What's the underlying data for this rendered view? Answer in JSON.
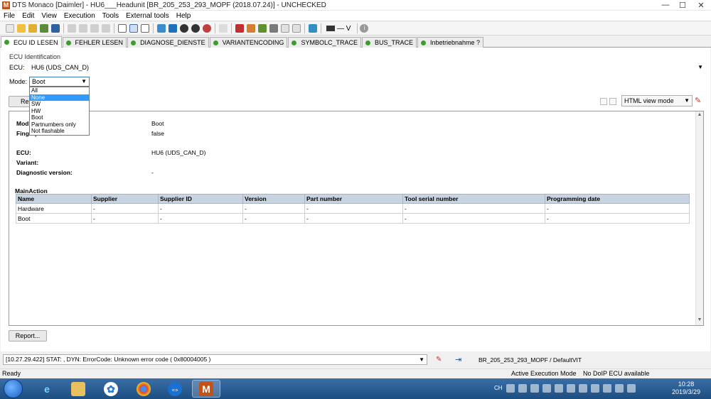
{
  "window": {
    "title": "DTS Monaco [Daimler] - HU6___Headunit [BR_205_253_293_MOPF (2018.07.24)] - UNCHECKED",
    "logo_letter": "M",
    "minimize": "—",
    "maximize": "☐",
    "close": "✕"
  },
  "menu": [
    "File",
    "Edit",
    "View",
    "Execution",
    "Tools",
    "External tools",
    "Help"
  ],
  "toolbar": {
    "voltage_label": "— V",
    "info_glyph": "i"
  },
  "tabs": [
    {
      "label": "ECU ID LESEN",
      "active": true
    },
    {
      "label": "FEHLER LESEN",
      "active": false
    },
    {
      "label": "DIAGNOSE_DIENSTE",
      "active": false
    },
    {
      "label": "VARIANTENCODING",
      "active": false
    },
    {
      "label": "SYMBOLC_TRACE",
      "active": false
    },
    {
      "label": "BUS_TRACE",
      "active": false
    },
    {
      "label": "Inbetriebnahme ?",
      "active": false
    }
  ],
  "panel": {
    "section_title": "ECU Identification",
    "ecu_label": "ECU:",
    "ecu_value": "HU6 (UDS_CAN_D)",
    "mode_label": "Mode:",
    "mode_value": "Boot",
    "mode_options": [
      "All",
      "None",
      "SW",
      "HW",
      "Boot",
      "Partnumbers only",
      "Not flashable"
    ],
    "mode_highlighted": "None",
    "read_button": "Re",
    "view_mode": "HTML view mode",
    "arrow_glyph": "▼"
  },
  "report": {
    "fields": [
      {
        "label": "Mod",
        "value": "Boot"
      },
      {
        "label": "Fingerprint read",
        "value": "false"
      },
      {
        "label": "ECU:",
        "value": "HU6 (UDS_CAN_D)"
      },
      {
        "label": "Variant:",
        "value": ""
      },
      {
        "label": "Diagnostic version:",
        "value": "-"
      }
    ],
    "main_action_title": "MainAction",
    "columns": [
      "Name",
      "Supplier",
      "Supplier ID",
      "Version",
      "Part number",
      "Tool serial number",
      "Programming date"
    ],
    "rows": [
      [
        "Hardware",
        "-",
        "-",
        "-",
        "-",
        "-",
        "-"
      ],
      [
        "Boot",
        "-",
        "-",
        "-",
        "-",
        "-",
        "-"
      ]
    ],
    "report_button": "Report..."
  },
  "status": {
    "log_line": "[10.27.29.422] STAT: , DYN:  ErrorCode: Unknown error code  ( 0x80004005 )",
    "vit": "BR_205_253_293_MOPF / DefaultVIT",
    "ready": "Ready",
    "exec_mode": "Active Execution Mode",
    "doip": "No DoIP ECU available"
  },
  "taskbar": {
    "lang": "CH",
    "time": "10:28",
    "date": "2019/3/29"
  }
}
